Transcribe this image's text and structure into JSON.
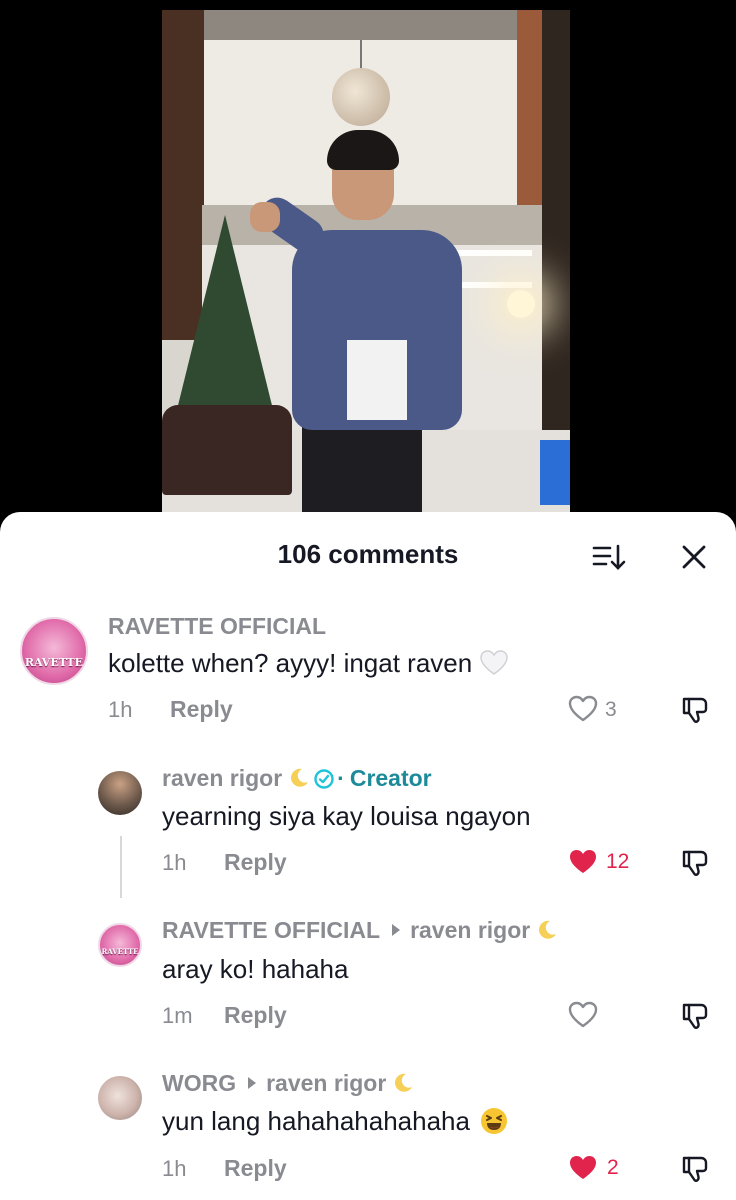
{
  "sheet": {
    "title": "106 comments"
  },
  "icons": {
    "sort": "sort-icon",
    "close": "close-icon",
    "like": "heart-outline-icon",
    "liked": "heart-filled-icon",
    "dislike": "thumbs-down-icon",
    "moon": "crescent-moon-emoji",
    "verified": "verified-check-icon"
  },
  "colors": {
    "liked": "#e0244c",
    "creator": "#1d8a99",
    "muted": "#8a8b91",
    "text": "#161823"
  },
  "comments": [
    {
      "author": "RAVETTE OFFICIAL",
      "avatar_text": "RAVETTE",
      "text": "kolette when? ayyy! ingat raven",
      "emoji": "white-heart",
      "time": "1h",
      "reply_label": "Reply",
      "likes": "3",
      "liked": false
    },
    {
      "author": "raven rigor",
      "creator_label": "Creator",
      "text": "yearning siya kay louisa ngayon",
      "time": "1h",
      "reply_label": "Reply",
      "likes": "12",
      "liked": true
    },
    {
      "author": "RAVETTE OFFICIAL",
      "avatar_text": "RAVETTE",
      "reply_to": "raven rigor",
      "text": "aray ko! hahaha",
      "time": "1m",
      "reply_label": "Reply",
      "likes": "",
      "liked": false
    },
    {
      "author": "WORG",
      "reply_to": "raven rigor",
      "text": "yun lang hahahahahahaha",
      "emoji": "laughing-face",
      "time": "1h",
      "reply_label": "Reply",
      "likes": "2",
      "liked": true
    }
  ]
}
